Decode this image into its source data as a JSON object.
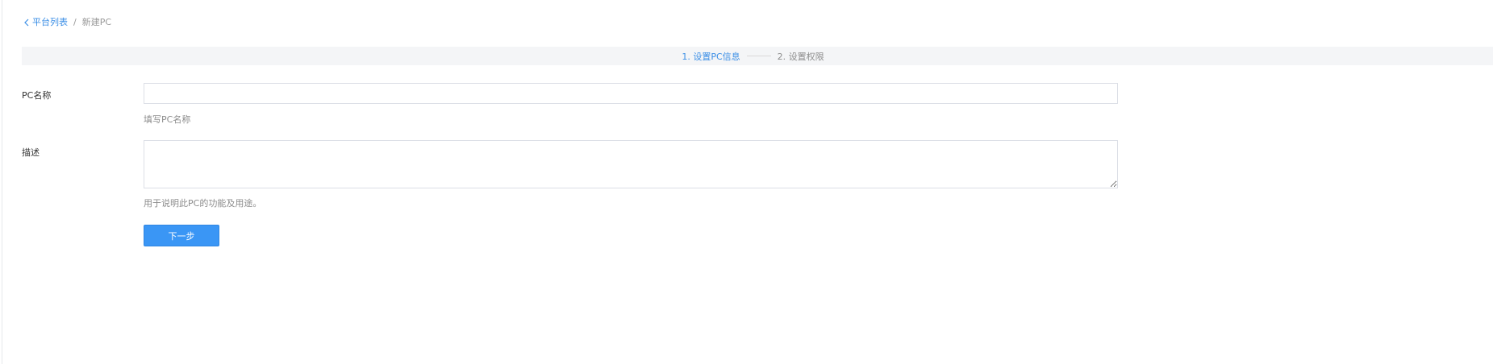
{
  "breadcrumb": {
    "back_label": "平台列表",
    "separator": "/",
    "current": "新建PC"
  },
  "steps": [
    {
      "label": "1. 设置PC信息",
      "active": true
    },
    {
      "label": "2. 设置权限",
      "active": false
    }
  ],
  "form": {
    "name_label": "PC名称",
    "name_value": "",
    "name_hint": "填写PC名称",
    "desc_label": "描述",
    "desc_value": "",
    "desc_hint": "用于说明此PC的功能及用途。",
    "next_button": "下一步"
  },
  "colors": {
    "accent": "#3a8ee6",
    "button": "#3a96f5",
    "steps_bg": "#f4f5f7",
    "muted_text": "#8c8c8c"
  }
}
